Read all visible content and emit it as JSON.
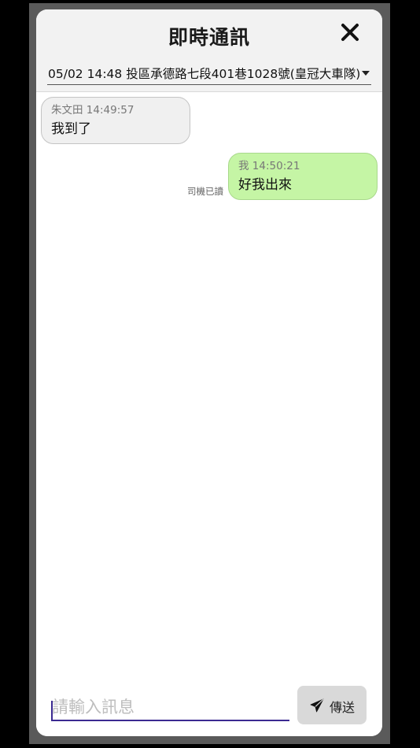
{
  "header": {
    "title": "即時通訊",
    "close_icon": "close-icon"
  },
  "order_select": {
    "selected": "05/02 14:48 投區承德路七段401巷1028號(皇冠大車隊)"
  },
  "messages": [
    {
      "direction": "incoming",
      "sender": "朱文田",
      "time": "14:49:57",
      "meta": "朱文田 14:49:57",
      "text": "我到了"
    },
    {
      "direction": "outgoing",
      "sender": "我",
      "time": "14:50:21",
      "meta": "我 14:50:21",
      "text": "好我出來",
      "read_status": "司機已讀"
    }
  ],
  "composer": {
    "placeholder": "請輸入訊息",
    "value": "",
    "send_label": "傳送",
    "send_icon": "paper-plane-icon"
  },
  "colors": {
    "outgoing_bubble": "#c5f5a5",
    "incoming_bubble": "#f0f0f0",
    "input_underline": "#3b2a91",
    "send_button": "#d9d9d9"
  }
}
